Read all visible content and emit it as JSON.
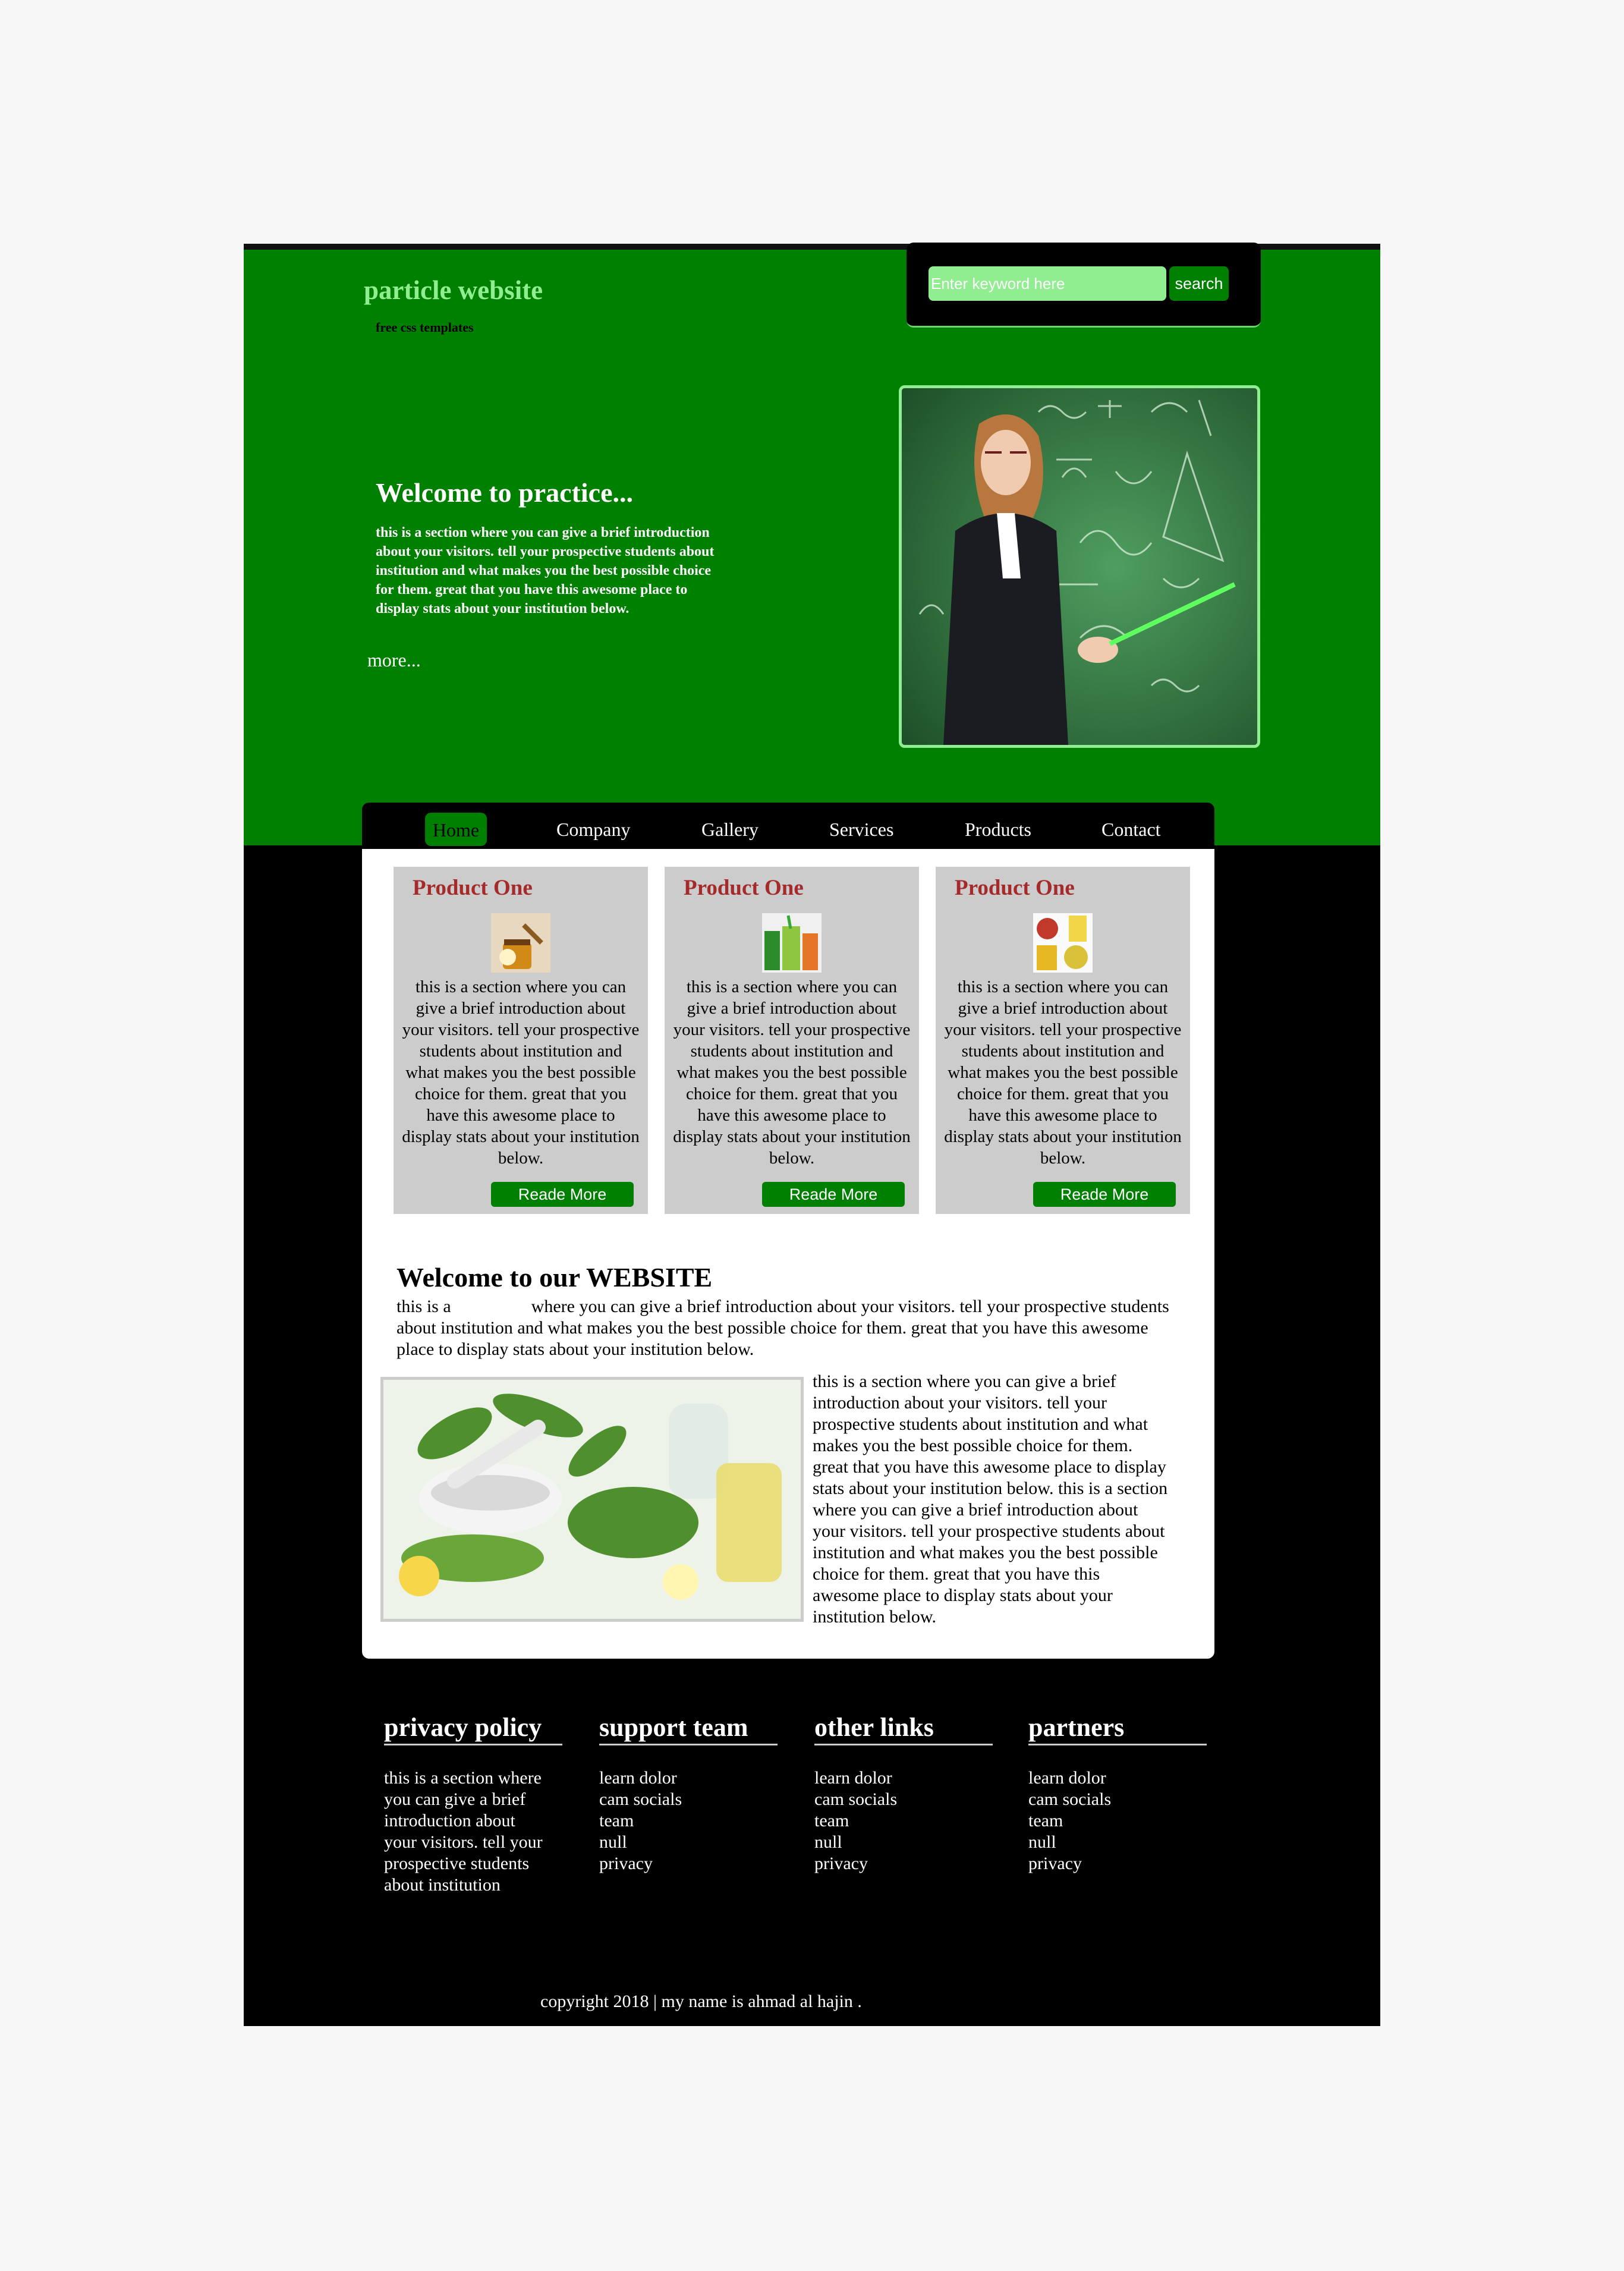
{
  "header": {
    "title": "particle website",
    "subtitle": "free css templates"
  },
  "search": {
    "placeholder": "Enter keyword here",
    "button": "search"
  },
  "hero": {
    "heading": "Welcome to practice...",
    "text": "this is a section where you can give a brief introduction about your visitors. tell your prospective students about institution and what makes you the best possible choice for them. great that you have this awesome place to display stats about your institution below.",
    "more": "more..."
  },
  "nav": {
    "items": [
      "Home",
      "Company",
      "Gallery",
      "Services",
      "Products",
      "Contact"
    ]
  },
  "cards": [
    {
      "title": "Product One",
      "text": "this is a section where you can give a brief introduction about your visitors. tell your prospective students about institution and what makes you the best possible choice for them. great that you have this awesome place to display stats about your institution below.",
      "button": "Reade More"
    },
    {
      "title": "Product One",
      "text": "this is a section where you can give a brief introduction about your visitors. tell your prospective students about institution and what makes you the best possible choice for them. great that you have this awesome place to display stats about your institution below.",
      "button": "Reade More"
    },
    {
      "title": "Product One",
      "text": "this is a section where you can give a brief introduction about your visitors. tell your prospective students about institution and what makes you the best possible choice for them. great that you have this awesome place to display stats about your institution below.",
      "button": "Reade More"
    }
  ],
  "welcome": {
    "heading": "Welcome to our WEBSITE",
    "text": "this is a                  where you can give a brief introduction about your visitors. tell your prospective students about institution and what makes you the best possible choice for them. great that you have this awesome place to display stats about your institution below.",
    "side_text": "this is a section where you can give a brief introduction about your visitors. tell your prospective students about institution and what makes you the best possible choice for them. great that you have this awesome place to display stats about your institution below. this is a section where you can give a brief introduction about your visitors. tell your prospective students about institution and what makes you the best possible choice for them. great that you have this awesome place to display stats about your institution below."
  },
  "footer": {
    "columns": [
      {
        "heading": "privacy policy",
        "lines": [
          "this is a section where",
          "you can give a brief",
          "introduction about",
          "your visitors. tell your",
          "prospective students",
          "about institution"
        ]
      },
      {
        "heading": "support team",
        "lines": [
          "learn dolor",
          "cam socials",
          "team",
          "null",
          "privacy"
        ]
      },
      {
        "heading": "other links",
        "lines": [
          "learn dolor",
          "cam socials",
          "team",
          "null",
          "privacy"
        ]
      },
      {
        "heading": "partners",
        "lines": [
          "learn dolor",
          "cam socials",
          "team",
          "null",
          "privacy"
        ]
      }
    ],
    "copyright": "copyright 2018 | my name is ahmad al hajin ."
  },
  "colors": {
    "green": "#008000",
    "light_green": "#90ee90",
    "card_title": "#a52a2a",
    "card_bg": "#cccccc"
  },
  "icons": [
    "teacher-photo",
    "honey-image",
    "smoothie-image",
    "fruit-image",
    "herbs-image"
  ]
}
